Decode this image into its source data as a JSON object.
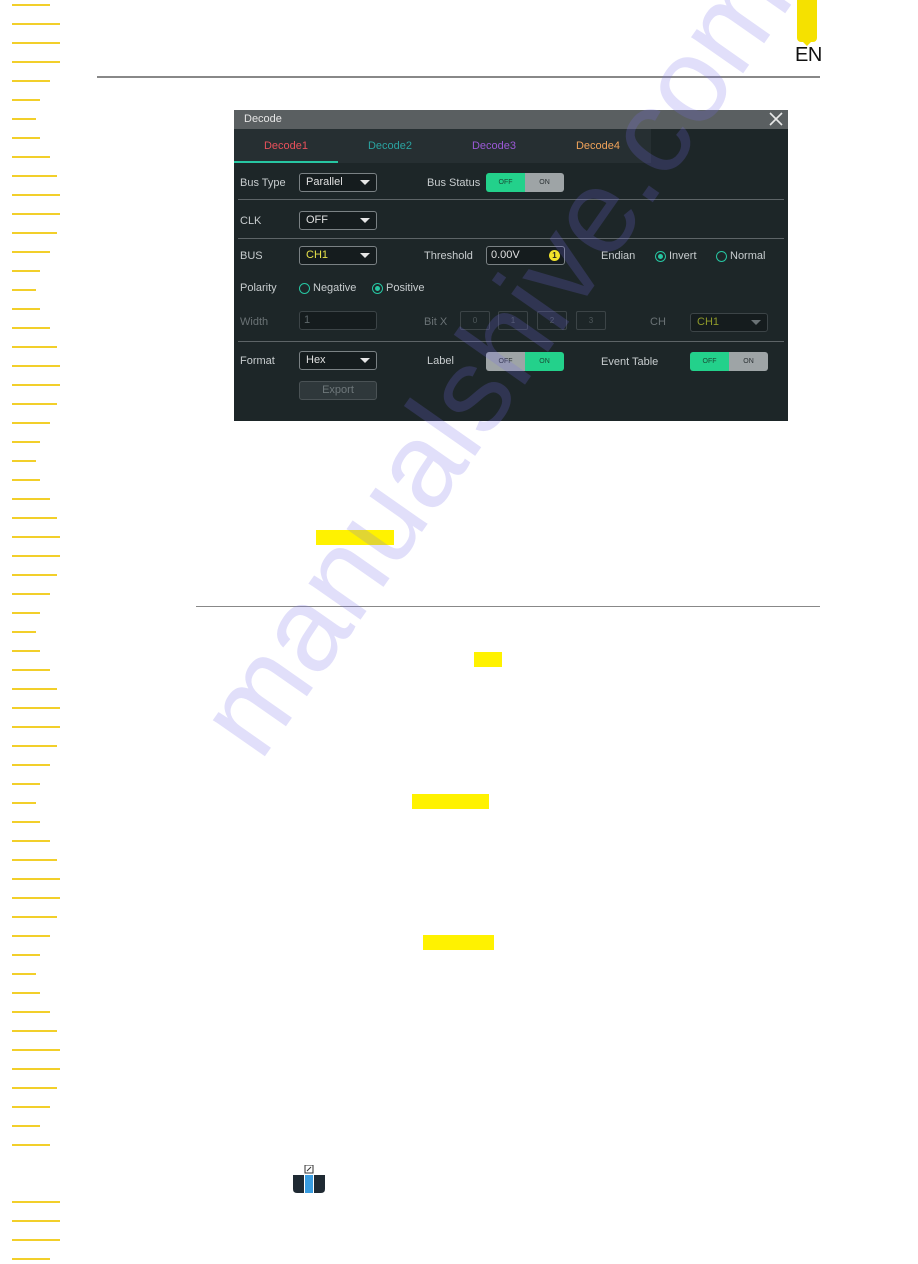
{
  "page": {
    "language_tab": "EN",
    "watermark": "manualshive.com",
    "accent_color": "#f5e100",
    "highlight_color": "#fff200",
    "edge_stripe_count": 60
  },
  "dialog": {
    "title": "Decode",
    "close_icon": "close-icon",
    "tabs": [
      {
        "label": "Decode1",
        "color": "#e8505b",
        "active": true
      },
      {
        "label": "Decode2",
        "color": "#2aa3a0",
        "active": false
      },
      {
        "label": "Decode3",
        "color": "#9b59d6",
        "active": false
      },
      {
        "label": "Decode4",
        "color": "#f0a35a",
        "active": false
      }
    ],
    "bus_type": {
      "label": "Bus Type",
      "value": "Parallel"
    },
    "bus_status": {
      "label": "Bus Status",
      "off": "OFF",
      "on": "ON",
      "state": "OFF"
    },
    "clk": {
      "label": "CLK",
      "value": "OFF"
    },
    "bus": {
      "label": "BUS",
      "value": "CH1"
    },
    "threshold": {
      "label": "Threshold",
      "value": "0.00V",
      "badge": "1"
    },
    "endian": {
      "label": "Endian",
      "options": [
        "Invert",
        "Normal"
      ],
      "selected": "Invert"
    },
    "polarity": {
      "label": "Polarity",
      "options": [
        "Negative",
        "Positive"
      ],
      "selected": "Positive"
    },
    "width": {
      "label": "Width",
      "value": "1"
    },
    "bit_x": {
      "label": "Bit X",
      "bits": [
        "0",
        "1",
        "2",
        "3"
      ]
    },
    "ch": {
      "label": "CH",
      "value": "CH1"
    },
    "format": {
      "label": "Format",
      "value": "Hex"
    },
    "label_toggle": {
      "label": "Label",
      "off": "OFF",
      "on": "ON",
      "state": "ON"
    },
    "event_table": {
      "label": "Event Table",
      "off": "OFF",
      "on": "ON",
      "state": "OFF"
    },
    "export_label": "Export"
  }
}
